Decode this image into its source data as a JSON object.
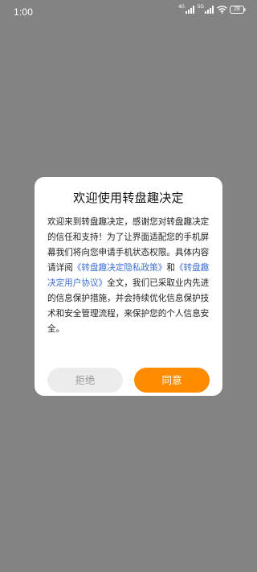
{
  "status_bar": {
    "time": "1:00",
    "net_tag_1": "4G",
    "net_tag_2": "5G",
    "battery_level": "28"
  },
  "dialog": {
    "title": "欢迎使用转盘趣决定",
    "body_intro": "欢迎来到转盘趣决定，感谢您对转盘趣决定的信任和支持！为了让界面适配您的手机屏幕我们将向您申请手机状态权限。具体内容请详阅",
    "privacy_link": "《转盘趣决定隐私政策》",
    "and_text": "和",
    "agreement_link": "《转盘趣决定用户协议》",
    "body_outro": "全文，我们已采取业内先进的信息保护措施，并会持续优化信息保护技术和安全管理流程，来保护您的个人信息安全。",
    "reject_label": "拒绝",
    "agree_label": "同意"
  },
  "colors": {
    "overlay": "#838383",
    "accent": "#ff8c00",
    "link": "#3f6fd0",
    "reject_bg": "#ececec"
  }
}
